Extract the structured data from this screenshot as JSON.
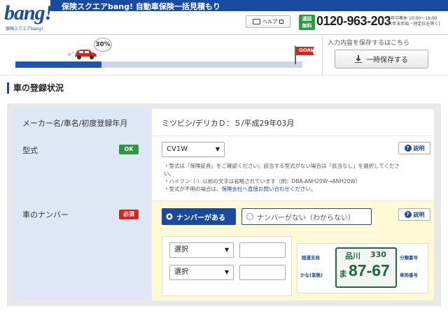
{
  "header": {
    "logo_text": "bang!",
    "logo_sub": "保険スクエアbang!",
    "bar_title": "保険スクエアbang! 自動車保険一括見積もり",
    "help_label": "ヘルプ",
    "free_label_1": "通話",
    "free_label_2": "無料",
    "phone": "0120-963-203",
    "hours_1": "年中無休 10:00～18:00",
    "hours_2": "(年末年始・特定日を除く)"
  },
  "progress": {
    "percent_label": "30%",
    "percent_value": 30,
    "goal_label": "GOAL!",
    "save_caption": "入力内容を保存するはこちら",
    "save_button": "一時保存する"
  },
  "section": {
    "title": "車の登録状況"
  },
  "form": {
    "row1": {
      "label": "メーカー名/車名/初度登録年月",
      "value": "ミツビシ/デリカＤ：５/平成29年03月"
    },
    "row2": {
      "label": "型式",
      "badge": "OK",
      "select_value": "CV1W",
      "help_label": "説明",
      "notes": [
        "・型式は「保険証券」をご確認ください。該当する型式がない場合は「該当なし」を選択してくださ",
        "い。",
        "・ハイフン（-）以前の文字は省略されています（例：DBA-ANH20W→ANH20W）",
        "・型式が不明の場合は、"
      ],
      "note_link": "保険会社へ直接お問い合わせください。"
    },
    "row3": {
      "label": "車のナンバー",
      "badge": "必須",
      "radio_yes": "ナンバーがある",
      "radio_no": "ナンバーがない（わからない）",
      "help_label": "説明",
      "select_1": "選択",
      "select_2": "選択",
      "plate": {
        "region_label": "陸運支局",
        "class_label": "分類番号",
        "kana_label": "かな(業態)",
        "number_label": "車両番号",
        "region": "品川",
        "class_num": "330",
        "kana": "ま",
        "number": "87-67"
      }
    }
  },
  "colors": {
    "brand_blue": "#1a4aa0",
    "ok_green": "#2a9a3c",
    "required_red": "#d9261c"
  }
}
